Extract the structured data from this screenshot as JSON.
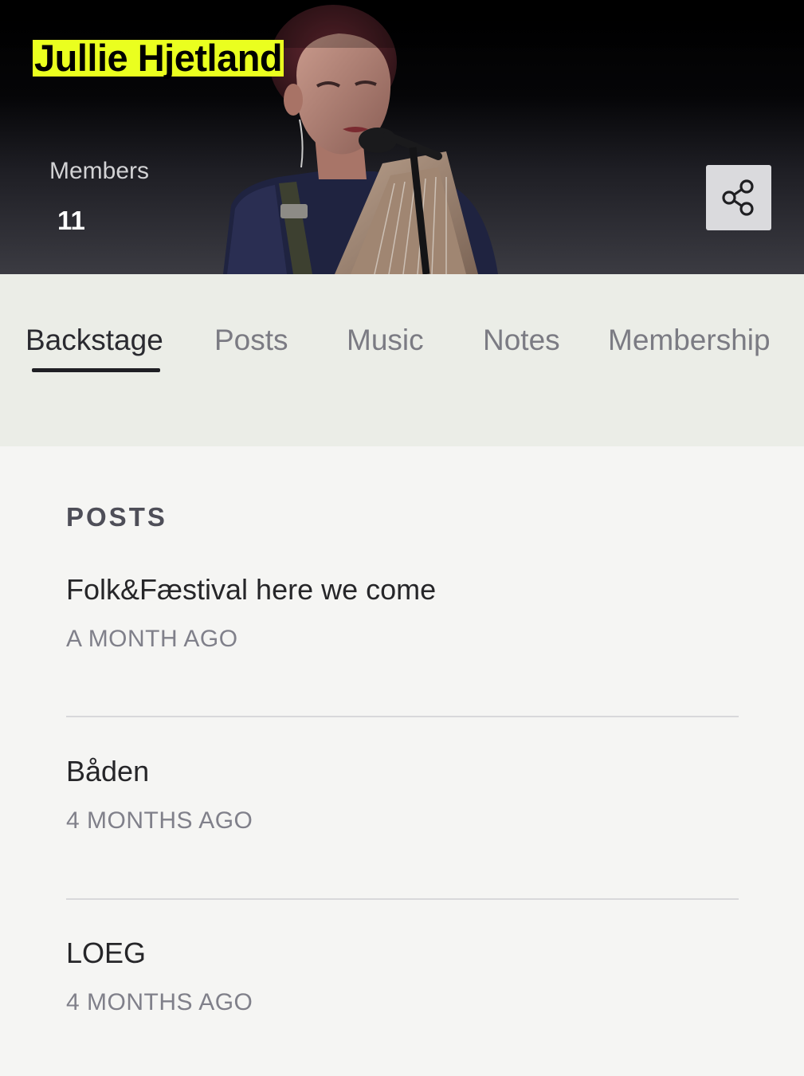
{
  "header": {
    "artist_name": "Jullie Hjetland",
    "members_label": "Members",
    "members_count": "11",
    "share_icon": "share-icon",
    "accent_color": "#eaff1f"
  },
  "tabs": [
    {
      "label": "Backstage",
      "active": true
    },
    {
      "label": "Posts",
      "active": false
    },
    {
      "label": "Music",
      "active": false
    },
    {
      "label": "Notes",
      "active": false
    },
    {
      "label": "Membership",
      "active": false
    }
  ],
  "posts_section": {
    "title": "POSTS",
    "items": [
      {
        "title": "Folk&Fæstival here we come",
        "time": "A MONTH AGO"
      },
      {
        "title": "Båden",
        "time": "4 MONTHS AGO"
      },
      {
        "title": "LOEG",
        "time": "4 MONTHS AGO"
      }
    ]
  }
}
